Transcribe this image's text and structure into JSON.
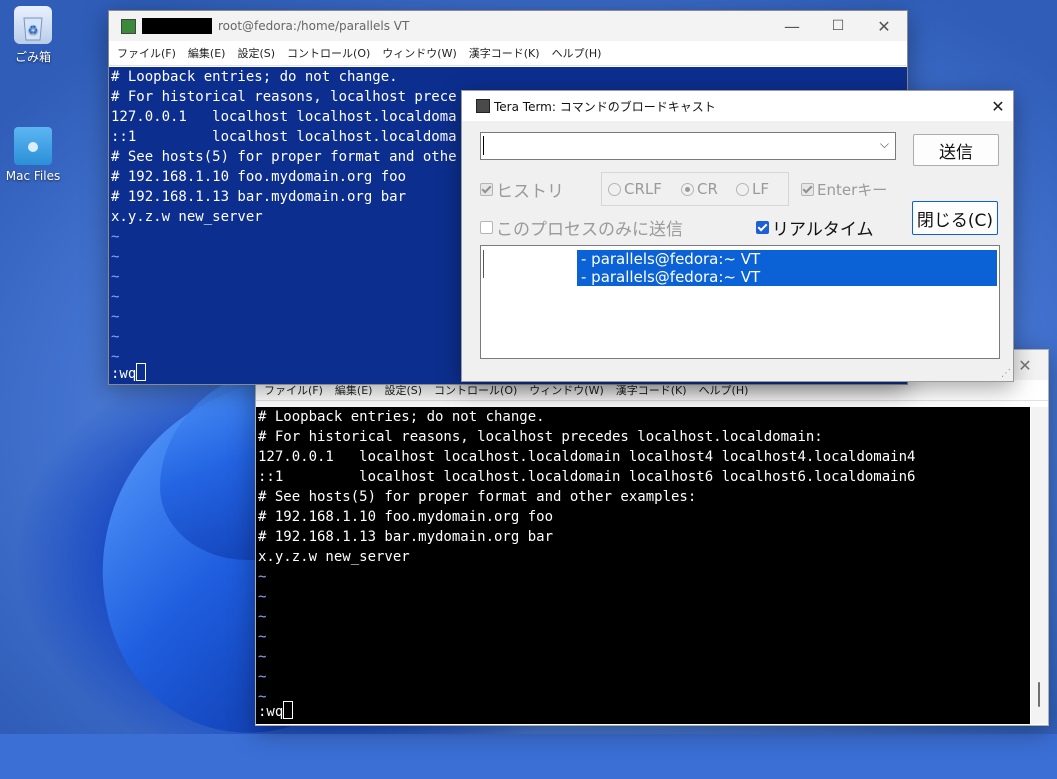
{
  "desktop": {
    "icons": [
      {
        "label": "ごみ箱",
        "icon": "recycle-bin-icon"
      },
      {
        "label": "Mac Files",
        "icon": "folder-icon"
      }
    ]
  },
  "window_top": {
    "title": "root@fedora:/home/parallels VT",
    "menu": [
      "ファイル(F)",
      "編集(E)",
      "設定(S)",
      "コントロール(O)",
      "ウィンドウ(W)",
      "漢字コード(K)",
      "ヘルプ(H)"
    ],
    "lines": [
      "# Loopback entries; do not change.",
      "# For historical reasons, localhost prece",
      "127.0.0.1   localhost localhost.localdoma",
      "::1         localhost localhost.localdoma",
      "# See hosts(5) for proper format and othe",
      "# 192.168.1.10 foo.mydomain.org foo",
      "# 192.168.1.13 bar.mydomain.org bar",
      "x.y.z.w new_server"
    ],
    "tildes": [
      "~",
      "~",
      "~",
      "~",
      "~",
      "~",
      "~",
      "~"
    ],
    "command": ":wq",
    "bg_color": "#0c2e8e"
  },
  "window_bottom": {
    "menu": [
      "ファイル(F)",
      "編集(E)",
      "設定(S)",
      "コントロール(O)",
      "ウィンドウ(W)",
      "漢字コード(K)",
      "ヘルプ(H)"
    ],
    "lines": [
      "# Loopback entries; do not change.",
      "# For historical reasons, localhost precedes localhost.localdomain:",
      "127.0.0.1   localhost localhost.localdomain localhost4 localhost4.localdomain4",
      "::1         localhost localhost.localdomain localhost6 localhost6.localdomain6",
      "# See hosts(5) for proper format and other examples:",
      "# 192.168.1.10 foo.mydomain.org foo",
      "# 192.168.1.13 bar.mydomain.org bar",
      "x.y.z.w new_server"
    ],
    "tildes": [
      "~",
      "~",
      "~",
      "~",
      "~",
      "~",
      "~"
    ],
    "command": ":wq",
    "bg_color": "#000000"
  },
  "dialog": {
    "title": "Tera Term: コマンドのブロードキャスト",
    "send_label": "送信",
    "close_label": "閉じる(C)",
    "history_label": "ヒストリ",
    "crlf_label": "CRLF",
    "cr_label": "CR",
    "lf_label": "LF",
    "enter_label": "Enterキー",
    "this_process_label": "このプロセスのみに送信",
    "realtime_label": "リアルタイム",
    "list_items": [
      "- parallels@fedora:~ VT",
      "- parallels@fedora:~ VT"
    ],
    "accent": "#0a62d6"
  }
}
